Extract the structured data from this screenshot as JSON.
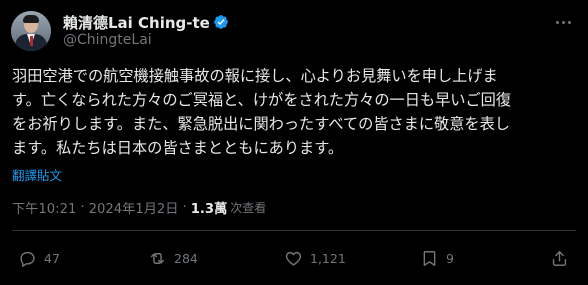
{
  "author": {
    "display_name": "賴清德Lai Ching-te",
    "handle": "@ChingteLai",
    "verified": true,
    "verified_color": "#1d9bf0"
  },
  "tweet": {
    "lines": [
      "羽田空港での航空機接触事故の報に接し、心よりお見舞いを申し上げま",
      "す。亡くなられた方々のご冥福と、けがをされた方々の一日も早いご回復",
      "をお祈りします。また、緊急脱出に関わったすべての皆さまに敬意を表し",
      "ます。私たちは日本の皆さまとともにあります。"
    ],
    "translate_label": "翻譯貼文",
    "time": "下午10:21",
    "separator": "·",
    "date": "2024年1月2日",
    "views_count": "1.3萬",
    "views_label": "次查看"
  },
  "actions": {
    "reply": {
      "icon": "reply-icon",
      "count": "47"
    },
    "retweet": {
      "icon": "retweet-icon",
      "count": "284"
    },
    "like": {
      "icon": "heart-icon",
      "count": "1,121"
    },
    "bookmark": {
      "icon": "bookmark-icon",
      "count": "9"
    },
    "share": {
      "icon": "share-icon"
    }
  },
  "colors": {
    "background": "#000000",
    "text": "#e7e9ea",
    "secondary": "#71767b",
    "link": "#1d9bf0",
    "divider": "#2f3336"
  }
}
